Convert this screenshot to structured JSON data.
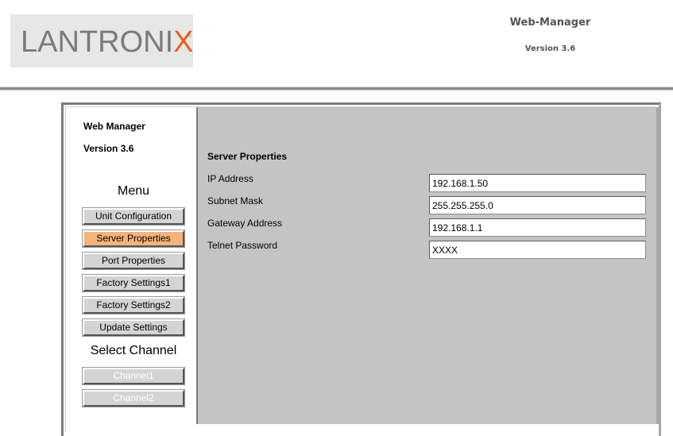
{
  "header": {
    "logo": {
      "text_main": "LANTRONI",
      "text_accent": "X",
      "registered": "®",
      "accent_color": "#e8601c"
    },
    "title": "Web-Manager",
    "version": "Version 3.6"
  },
  "sidebar": {
    "title": "Web Manager",
    "version": "Version 3.6",
    "menu_heading": "Menu",
    "menu_items": [
      {
        "label": "Unit Configuration",
        "active": false
      },
      {
        "label": "Server Properties",
        "active": true
      },
      {
        "label": "Port Properties",
        "active": false
      },
      {
        "label": "Factory Settings1",
        "active": false
      },
      {
        "label": "Factory Settings2",
        "active": false
      },
      {
        "label": "Update Settings",
        "active": false
      }
    ],
    "channel_heading": "Select Channel",
    "channel_items": [
      {
        "label": "Channel1",
        "disabled": true
      },
      {
        "label": "Channel2",
        "disabled": true
      }
    ]
  },
  "content": {
    "title": "Server Properties",
    "fields": [
      {
        "label": "IP Address",
        "value": "192.168.1.50"
      },
      {
        "label": "Subnet Mask",
        "value": "255.255.255.0"
      },
      {
        "label": "Gateway Address",
        "value": "192.168.1.1"
      },
      {
        "label": "Telnet Password",
        "value": "XXXX"
      }
    ]
  },
  "colors": {
    "active_button": "#f4b37a",
    "content_background": "#c4c4c4",
    "button_face": "#d4d4d4"
  }
}
